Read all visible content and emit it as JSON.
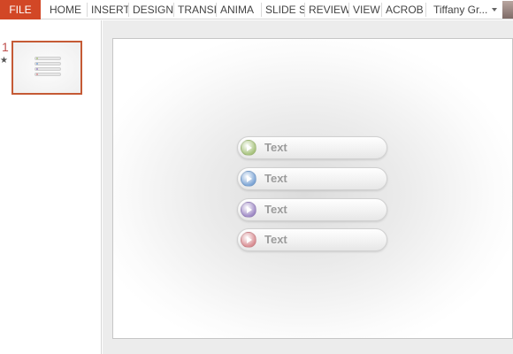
{
  "ribbon": {
    "file_label": "FILE",
    "tabs": [
      "HOME",
      "INSERT",
      "DESIGN",
      "TRANSI",
      "ANIMA",
      "SLIDE S",
      "REVIEW",
      "VIEW",
      "ACROB"
    ],
    "user_name": "Tiffany Gr..."
  },
  "thumbnails": {
    "slide_number": "1",
    "transition_marker": "★"
  },
  "slide": {
    "items": [
      {
        "label": "Text",
        "accent": "#a9c47f"
      },
      {
        "label": "Text",
        "accent": "#7ea6d6"
      },
      {
        "label": "Text",
        "accent": "#a08bc6"
      },
      {
        "label": "Text",
        "accent": "#d98e93"
      }
    ]
  },
  "colors": {
    "file_tab": "#d24726",
    "selected_thumbnail_border": "#c55a35"
  }
}
